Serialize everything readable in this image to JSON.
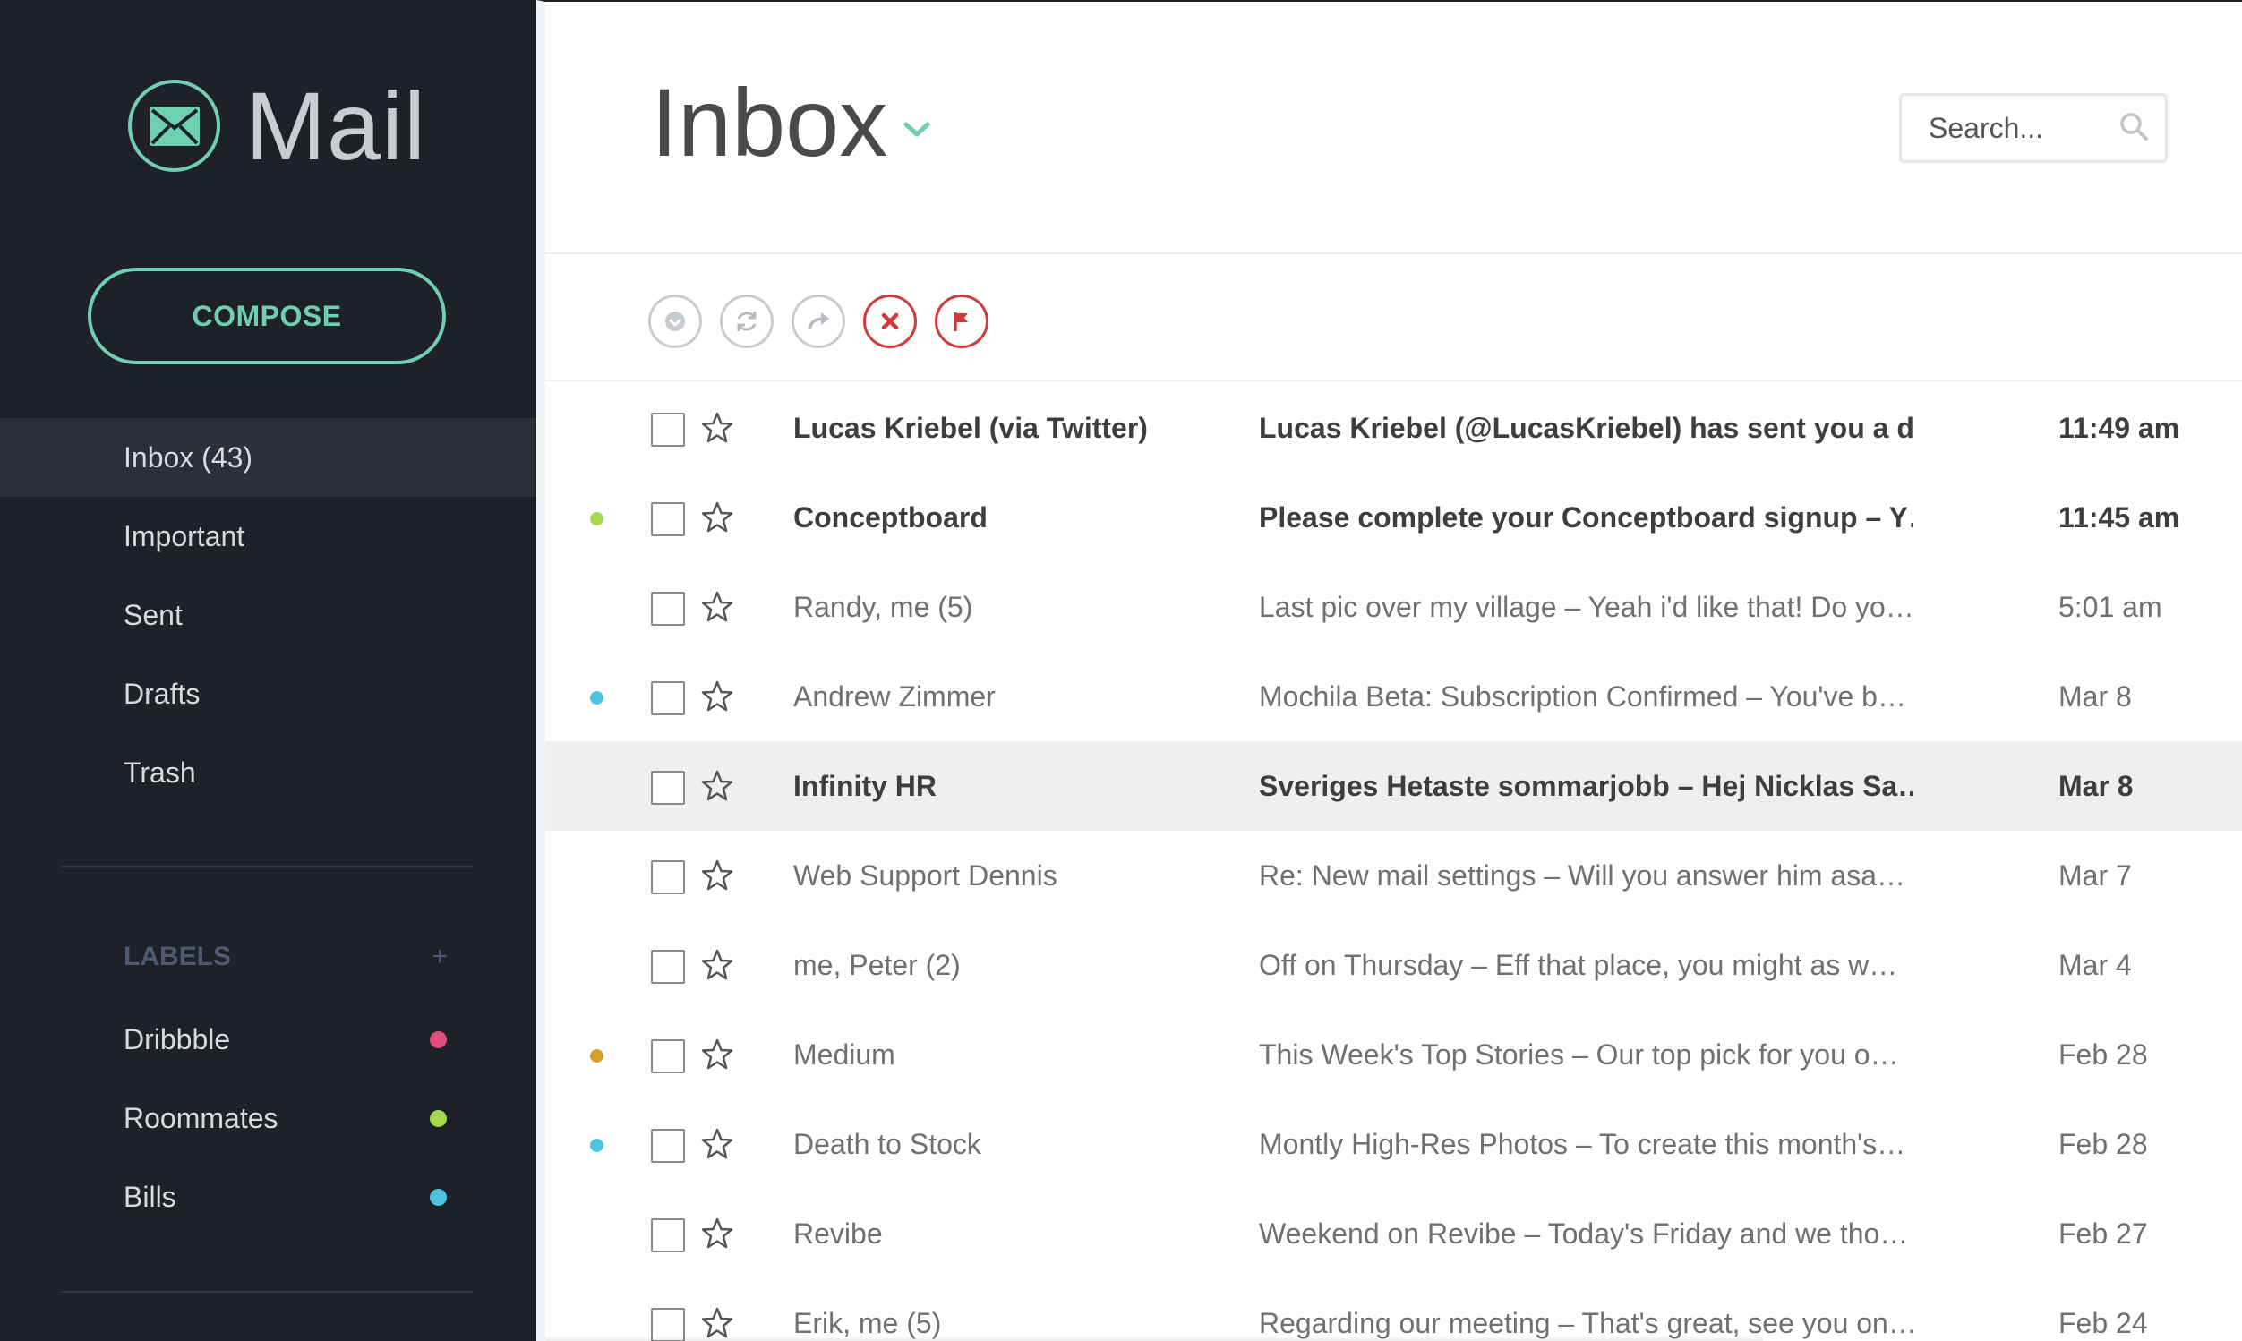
{
  "app": {
    "name": "Mail"
  },
  "sidebar": {
    "compose_label": "COMPOSE",
    "nav": [
      {
        "label": "Inbox (43)",
        "active": true
      },
      {
        "label": "Important",
        "active": false
      },
      {
        "label": "Sent",
        "active": false
      },
      {
        "label": "Drafts",
        "active": false
      },
      {
        "label": "Trash",
        "active": false
      }
    ],
    "labels_heading": "LABELS",
    "labels_add": "+",
    "labels": [
      {
        "name": "Dribbble",
        "color": "#e04b7c"
      },
      {
        "name": "Roommates",
        "color": "#a3d94a"
      },
      {
        "name": "Bills",
        "color": "#4fc3e0"
      }
    ]
  },
  "header": {
    "title": "Inbox",
    "search_placeholder": "Search..."
  },
  "toolbar": {
    "actions": [
      "check-all-icon",
      "refresh-icon",
      "forward-icon",
      "delete-icon",
      "flag-icon"
    ]
  },
  "emails": [
    {
      "from": "Lucas Kriebel (via Twitter)",
      "subject": "Lucas Kriebel (@LucasKriebel) has sent you a dir…",
      "date": "11:49 am",
      "unread": true,
      "dot": null,
      "highlighted": false
    },
    {
      "from": "Conceptboard",
      "subject": "Please complete your Conceptboard signup  –  Y…",
      "date": "11:45 am",
      "unread": true,
      "dot": "#a3d94a",
      "highlighted": false
    },
    {
      "from": "Randy, me (5)",
      "subject": "Last pic over my village  –  Yeah i'd like that! Do yo…",
      "date": "5:01 am",
      "unread": false,
      "dot": null,
      "highlighted": false
    },
    {
      "from": "Andrew Zimmer",
      "subject": "Mochila Beta: Subscription Confirmed  –  You've b…",
      "date": "Mar 8",
      "unread": false,
      "dot": "#4fc3e0",
      "highlighted": false
    },
    {
      "from": "Infinity HR",
      "subject": "Sveriges Hetaste sommarjobb  –  Hej Nicklas Sa…",
      "date": "Mar 8",
      "unread": true,
      "dot": null,
      "highlighted": true
    },
    {
      "from": "Web Support Dennis",
      "subject": "Re: New mail settings  –  Will you answer him asa…",
      "date": "Mar 7",
      "unread": false,
      "dot": null,
      "highlighted": false
    },
    {
      "from": "me, Peter (2)",
      "subject": "Off on Thursday  –  Eff that place, you might as w…",
      "date": "Mar 4",
      "unread": false,
      "dot": null,
      "highlighted": false
    },
    {
      "from": "Medium",
      "subject": "This Week's Top Stories  –  Our top pick for you o…",
      "date": "Feb 28",
      "unread": false,
      "dot": "#d4a028",
      "highlighted": false
    },
    {
      "from": "Death to Stock",
      "subject": "Montly High-Res Photos  –  To create this month's…",
      "date": "Feb 28",
      "unread": false,
      "dot": "#4fc3e0",
      "highlighted": false
    },
    {
      "from": "Revibe",
      "subject": "Weekend on Revibe  –  Today's Friday and we tho…",
      "date": "Feb 27",
      "unread": false,
      "dot": null,
      "highlighted": false
    },
    {
      "from": "Erik, me (5)",
      "subject": "Regarding our meeting  –  That's great, see you on…",
      "date": "Feb 24",
      "unread": false,
      "dot": null,
      "highlighted": false
    }
  ],
  "colors": {
    "accent": "#6fcfb1",
    "danger": "#d13a3a",
    "sidebar_bg": "#1e2127"
  }
}
